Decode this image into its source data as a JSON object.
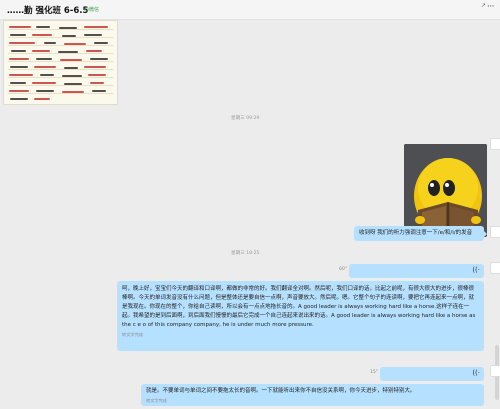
{
  "header": {
    "title": "……勤 强化班 6-6.5",
    "subtitle": "@微信",
    "more_icon": "···"
  },
  "messages": {
    "ts1": "星期三 09:29",
    "ts2": "星期三 18:25",
    "short_text": "收到呀 我们的听力强调注意一下/e/和/i/的发音",
    "voice1_duration": "60\"",
    "voice2_duration": "15\"",
    "voice1_transcript": "呵，晚上好，宝宝们今天的翻译和口译啊，都做的非常的好。我们翻译全对啊。然后呢，我们口译的话，比起之前呢，有很大很大的进步，很棒很棒啊。今天的单词发音没有什么问题，但是整体还是要自信一点啊，声音要放大。然后呢。嗯。它整个句子的连读啊，要把它再连起来一点啊，就是我现在。你现在的整个，你给自己读啊，所以会有一点点地拖长音的。A good leader is always working hard like a horse.这样子连在一起。我希望的是到后面啊，到后面我们慢慢的最后它完成一个自己连起来说出来的话。A good leader is always working hard like a horse as the c e o of this company company, he is under much more pressure.",
    "voice2_transcript": "就是。不要单词与单词之间不要拖太长的音啊。一下就能听出来你不自信没关系啊，你今天进步，特别特别大。",
    "convert_note": "转文字完成"
  }
}
